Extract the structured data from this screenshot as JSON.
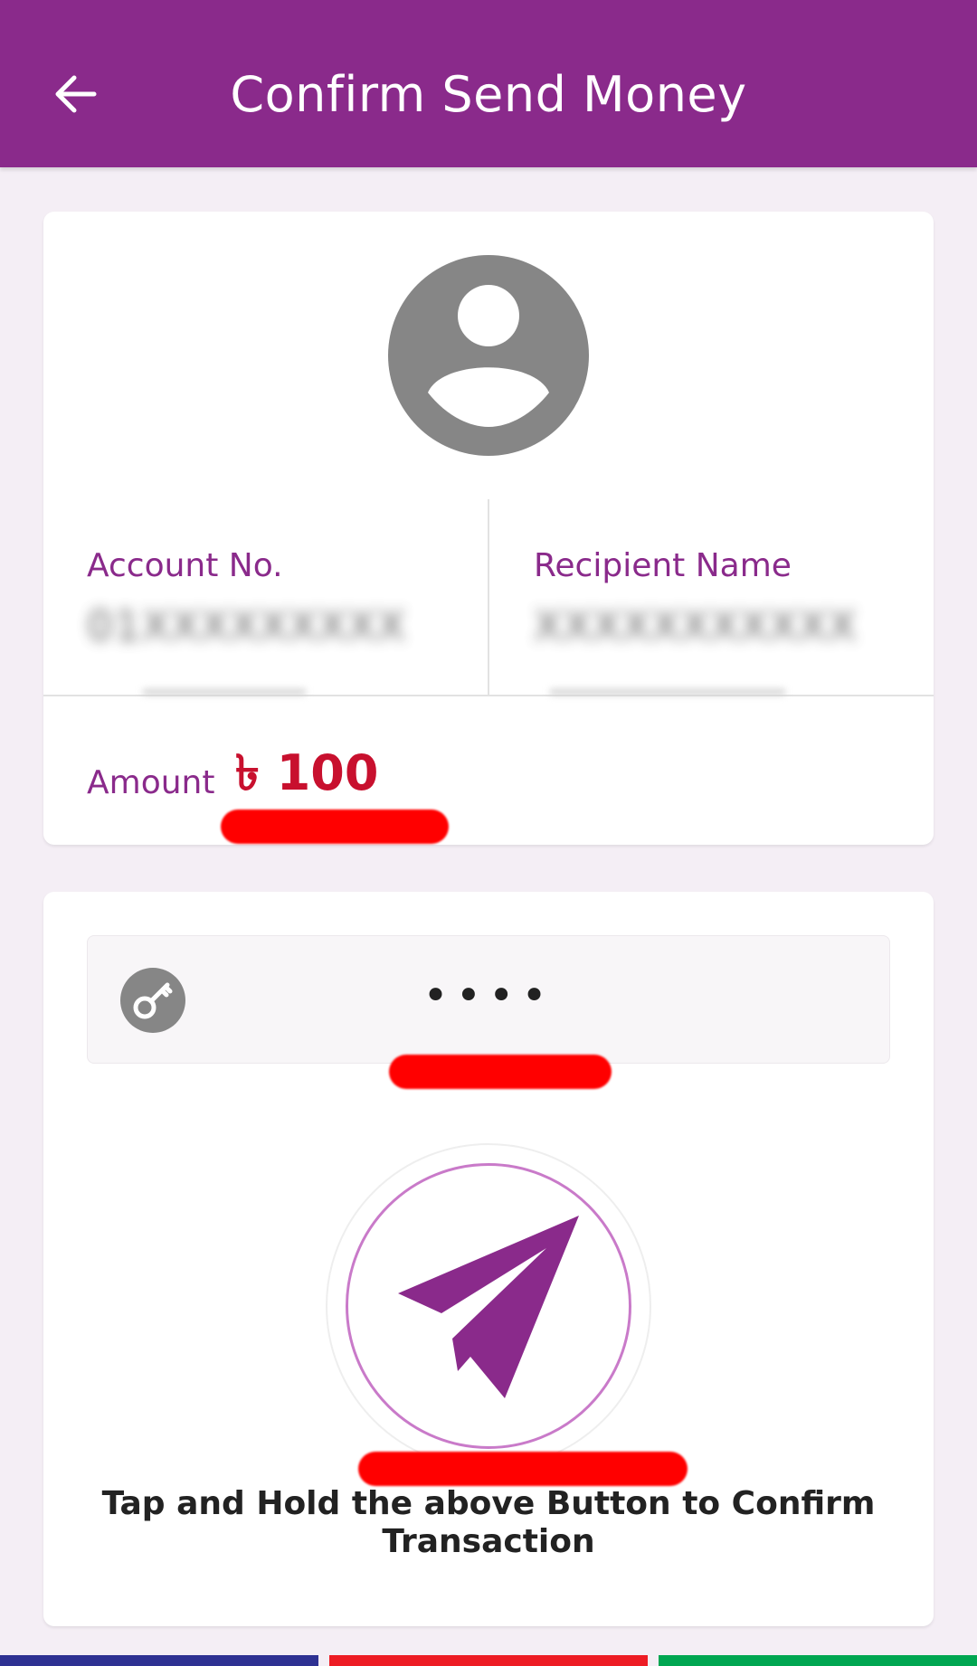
{
  "header": {
    "title": "Confirm Send Money",
    "back_icon": "arrow-left-icon",
    "background_color": "#8a2a8b"
  },
  "details": {
    "avatar_icon": "user-avatar-icon",
    "account_label": "Account No.",
    "account_value": "01XXXXXXXXX",
    "recipient_label": "Recipient Name",
    "recipient_value": "XXXXXXXXXXX",
    "amount_label": "Amount",
    "amount_value": "৳ 100",
    "amount_color": "#c8102e"
  },
  "pin": {
    "icon": "key-icon",
    "masked_value": "••••"
  },
  "confirm": {
    "button_icon": "paper-plane-icon",
    "hint": "Tap and Hold the above Button to Confirm Transaction"
  },
  "bottom_bar_colors": [
    "#2e3192",
    "#ed1c24",
    "#00a651"
  ]
}
